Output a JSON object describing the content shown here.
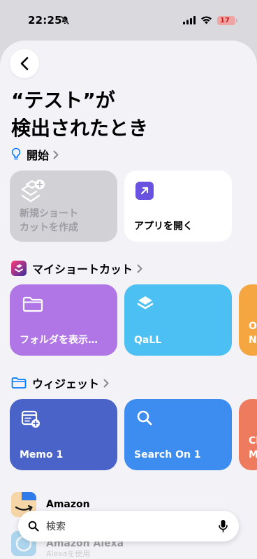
{
  "status": {
    "time": "22:25",
    "battery": "17"
  },
  "header": {
    "title_line1": "“テスト”が",
    "title_line2": "検出されたとき"
  },
  "sections": {
    "start": "開始",
    "my_shortcuts": "マイショートカット",
    "widgets": "ウィジェット"
  },
  "cards": {
    "new_shortcut_line1": "新規ショート",
    "new_shortcut_line2": "カットを作成",
    "open_app": "アプリを開く",
    "show_folder": "フォルダを表示…",
    "qall": "QaLL",
    "partial1_line1": "O",
    "partial1_line2": "N",
    "memo": "Memo 1",
    "search_on": "Search On 1",
    "partial2_line1": "Cl",
    "partial2_line2": "M"
  },
  "apps": [
    {
      "name": "Amazon",
      "sub": ""
    },
    {
      "name": "Amazon Alexa",
      "sub": "Alexaを使用"
    }
  ],
  "search": {
    "placeholder": "検索"
  },
  "colors": {
    "accent": "#007aff",
    "folder_card": "#b076e6",
    "qall_card": "#4cc0f2",
    "memo_card": "#4a63c8",
    "search_card": "#3d8cf0"
  }
}
